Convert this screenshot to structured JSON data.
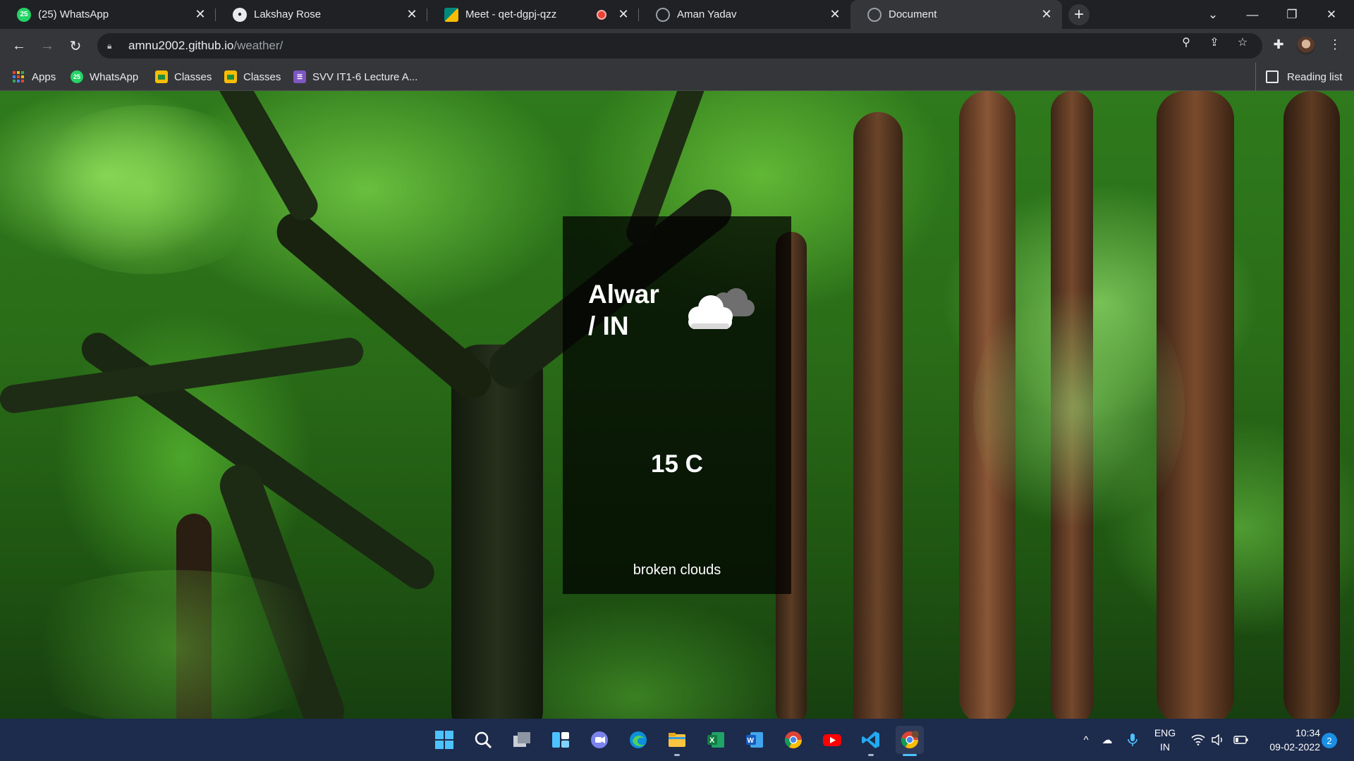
{
  "browser": {
    "tabs": [
      {
        "title": "(25) WhatsApp",
        "favicon": "whatsapp-icon",
        "badge": "25",
        "color": "#25d366"
      },
      {
        "title": "Lakshay Rose",
        "favicon": "github-icon",
        "color": "#e8eaed"
      },
      {
        "title": "Meet - qet-dgpj-qzz",
        "favicon": "meet-icon",
        "color": "#00897b"
      },
      {
        "title": "Aman Yadav",
        "favicon": "globe-icon",
        "color": "#9aa0a6"
      },
      {
        "title": "Document",
        "favicon": "globe-icon",
        "color": "#9aa0a6"
      }
    ],
    "active_tab": "Document",
    "address": {
      "host": "amnu2002.github.io",
      "path": "/weather/"
    },
    "bookmarks": [
      {
        "label": "Apps",
        "icon": "apps-grid-icon"
      },
      {
        "label": "WhatsApp",
        "icon": "whatsapp-icon",
        "badge": "25"
      },
      {
        "label": "Classes",
        "icon": "classroom-icon"
      },
      {
        "label": "Classes",
        "icon": "classroom-icon"
      },
      {
        "label": "SVV IT1-6 Lecture A...",
        "icon": "list-icon"
      }
    ],
    "reading_list": "Reading list"
  },
  "weather": {
    "city": "Alwar",
    "country_line": "/ IN",
    "temperature": "15 C",
    "description": "broken clouds",
    "icon": "broken-clouds-icon"
  },
  "taskbar": {
    "apps": [
      "windows-start-icon",
      "search-icon",
      "task-view-icon",
      "widgets-icon",
      "teams-chat-icon",
      "edge-icon",
      "file-explorer-icon",
      "excel-icon",
      "word-icon",
      "chrome-icon",
      "youtube-icon",
      "vscode-icon",
      "chrome-profile-icon"
    ],
    "language": {
      "line1": "ENG",
      "line2": "IN"
    },
    "time": "10:34",
    "date": "09-02-2022",
    "notifications": "2"
  },
  "colors": {
    "accent": "#4cc2ff",
    "card_background": "rgba(0,0,0,0.74)",
    "taskbar": "#1d2b4c"
  }
}
